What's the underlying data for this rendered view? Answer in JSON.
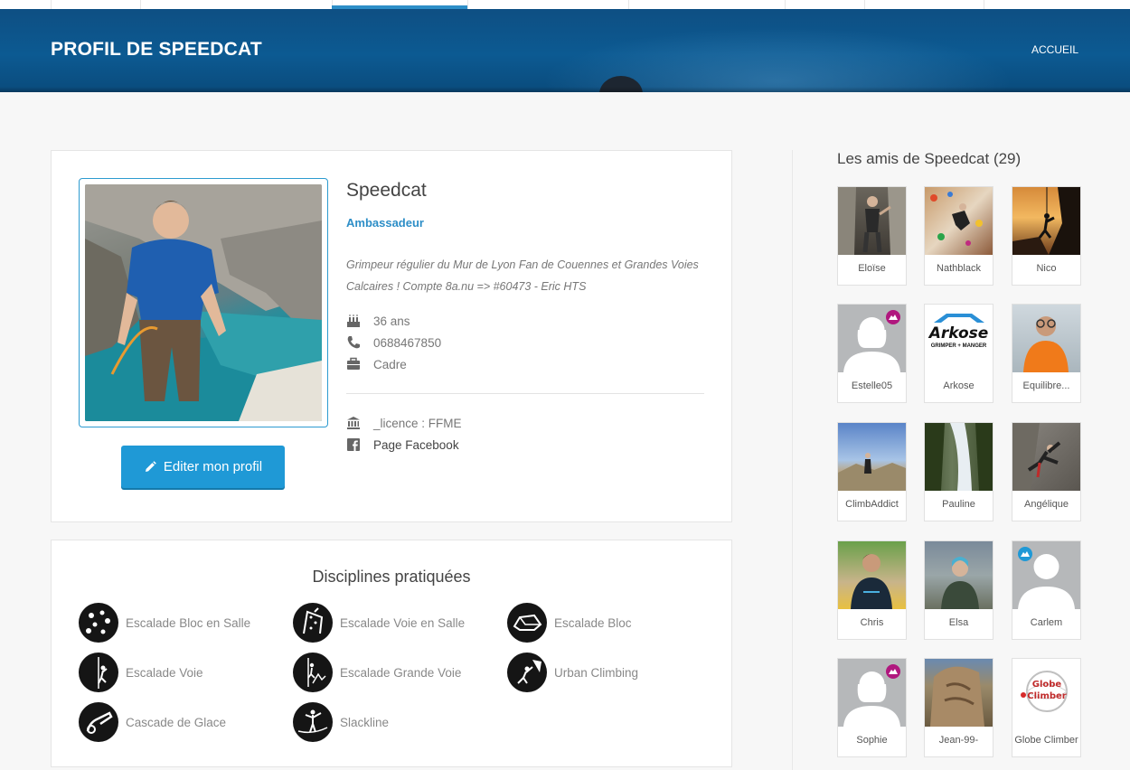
{
  "header": {
    "title": "PROFIL DE SPEEDCAT",
    "nav_home": "ACCUEIL"
  },
  "profile": {
    "username": "Speedcat",
    "badge": "Ambassadeur",
    "bio": "Grimpeur régulier du Mur de Lyon Fan de Couennes et Grandes Voies Calcaires ! Compte 8a.nu => #60473 - Eric HTS",
    "age": "36 ans",
    "phone": "0688467850",
    "job": "Cadre",
    "licence": "_licence : FFME",
    "facebook": "Page Facebook",
    "edit_button": "Editer mon profil"
  },
  "disciplines": {
    "title": "Disciplines pratiquées",
    "items": [
      {
        "label": "Escalade Bloc en Salle",
        "icon": "bloc-salle-icon"
      },
      {
        "label": "Escalade Voie en Salle",
        "icon": "voie-salle-icon"
      },
      {
        "label": "Escalade Bloc",
        "icon": "bloc-icon"
      },
      {
        "label": "Escalade Voie",
        "icon": "voie-icon"
      },
      {
        "label": "Escalade Grande Voie",
        "icon": "grande-voie-icon"
      },
      {
        "label": "Urban Climbing",
        "icon": "urban-climbing-icon"
      },
      {
        "label": "Cascade de Glace",
        "icon": "cascade-glace-icon"
      },
      {
        "label": "Slackline",
        "icon": "slackline-icon"
      }
    ]
  },
  "friends": {
    "title": "Les amis de Speedcat (29)",
    "items": [
      {
        "name": "Eloïse"
      },
      {
        "name": "Nathblack"
      },
      {
        "name": "Nico"
      },
      {
        "name": "Estelle05"
      },
      {
        "name": "Arkose",
        "logo_text": "Arkose",
        "logo_sub": "GRIMPER + MANGER"
      },
      {
        "name": "Equilibre..."
      },
      {
        "name": "ClimbAddict"
      },
      {
        "name": "Pauline"
      },
      {
        "name": "Angélique"
      },
      {
        "name": "Chris"
      },
      {
        "name": "Elsa"
      },
      {
        "name": "Carlem"
      },
      {
        "name": "Sophie"
      },
      {
        "name": "Jean-99-"
      },
      {
        "name": "Globe Climber",
        "logo_text": "Globe Climber"
      }
    ]
  },
  "colors": {
    "header_bg": "#0c5a92",
    "accent": "#1f99d6",
    "badge": "#2d8ec7",
    "female_dot": "#b0177e",
    "male_dot": "#1f99d6"
  }
}
